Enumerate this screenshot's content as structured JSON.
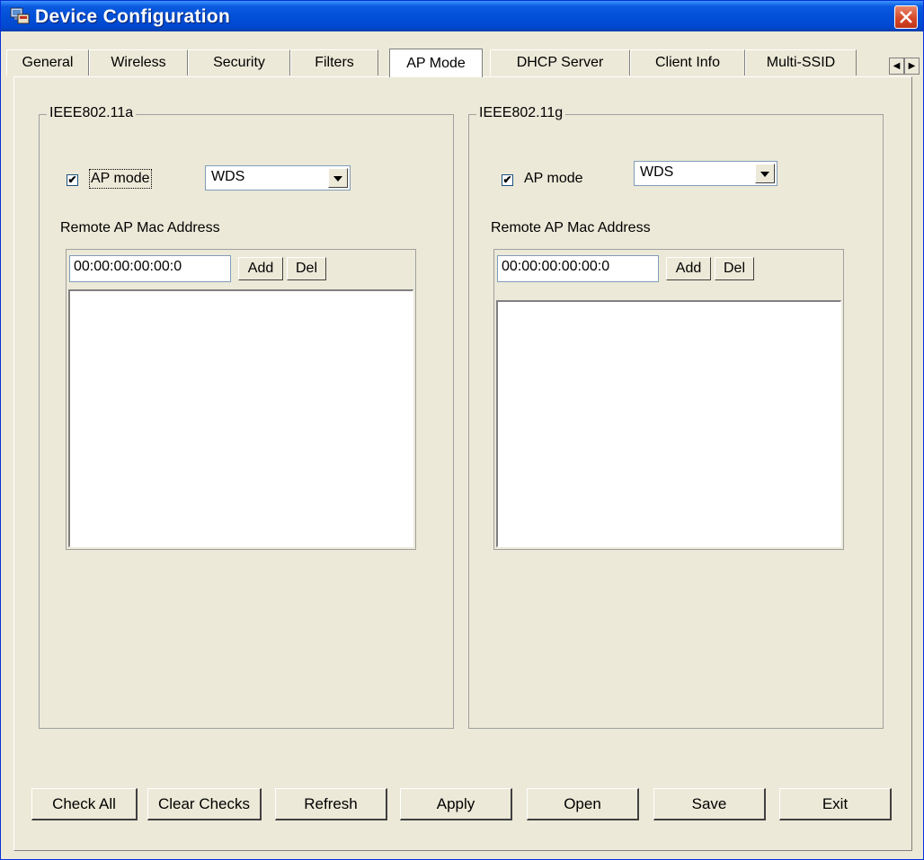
{
  "window": {
    "title": "Device Configuration"
  },
  "tabs": [
    {
      "label": "General"
    },
    {
      "label": "Wireless"
    },
    {
      "label": "Security"
    },
    {
      "label": "Filters"
    },
    {
      "label": "AP Mode",
      "active": true
    },
    {
      "label": "DHCP Server"
    },
    {
      "label": "Client Info"
    },
    {
      "label": "Multi-SSID"
    }
  ],
  "groups": {
    "a": {
      "title": "IEEE802.11a",
      "ap_mode_checked": true,
      "ap_mode_label": "AP mode",
      "mode_value": "WDS",
      "remote_label": "Remote AP Mac Address",
      "mac_value": "00:00:00:00:00:0",
      "add_label": "Add",
      "del_label": "Del"
    },
    "g": {
      "title": "IEEE802.11g",
      "ap_mode_checked": true,
      "ap_mode_label": "AP mode",
      "mode_value": "WDS",
      "remote_label": "Remote AP Mac Address",
      "mac_value": "00:00:00:00:00:0",
      "add_label": "Add",
      "del_label": "Del"
    }
  },
  "buttons": {
    "check_all": "Check All",
    "clear_checks": "Clear Checks",
    "refresh": "Refresh",
    "apply": "Apply",
    "open": "Open",
    "save": "Save",
    "exit": "Exit"
  },
  "icons": {
    "app": "device-config-icon",
    "close": "close-icon",
    "tab_left": "arrow-left-icon",
    "tab_right": "arrow-right-icon",
    "dropdown": "chevron-down-icon"
  },
  "colors": {
    "titlebar": "#0350d8",
    "face": "#ece9d8",
    "close": "#d6492a"
  }
}
